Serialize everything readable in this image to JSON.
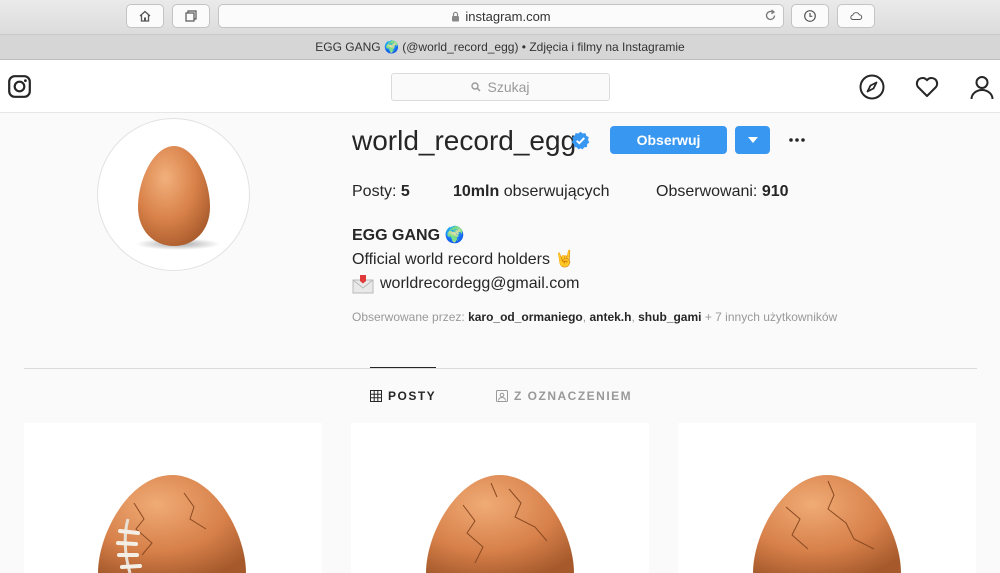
{
  "browser": {
    "url": "instagram.com",
    "tab_title": "EGG GANG 🌍 (@world_record_egg) • Zdjęcia i filmy na Instagramie"
  },
  "header": {
    "search_placeholder": "Szukaj"
  },
  "profile": {
    "username": "world_record_egg",
    "follow_label": "Obserwuj",
    "stats": {
      "posts_label": "Posty:",
      "posts_value": "5",
      "followers_value": "10mln",
      "followers_label": "obserwujących",
      "following_label": "Obserwowani:",
      "following_value": "910"
    },
    "full_name": "EGG GANG 🌍",
    "bio_line1": "Official world record holders 🤘",
    "bio_line2": "worldrecordegg@gmail.com",
    "followed_by_label": "Obserwowane przez:",
    "followed_by_users": [
      "karo_od_ormaniego",
      "antek.h",
      "shub_gami"
    ],
    "followed_by_more": "+ 7 innych użytkowników"
  },
  "tabs": {
    "posts": "POSTY",
    "tagged": "Z OZNACZENIEM"
  },
  "colors": {
    "accent": "#3897f0",
    "egg": "#d9824a"
  }
}
